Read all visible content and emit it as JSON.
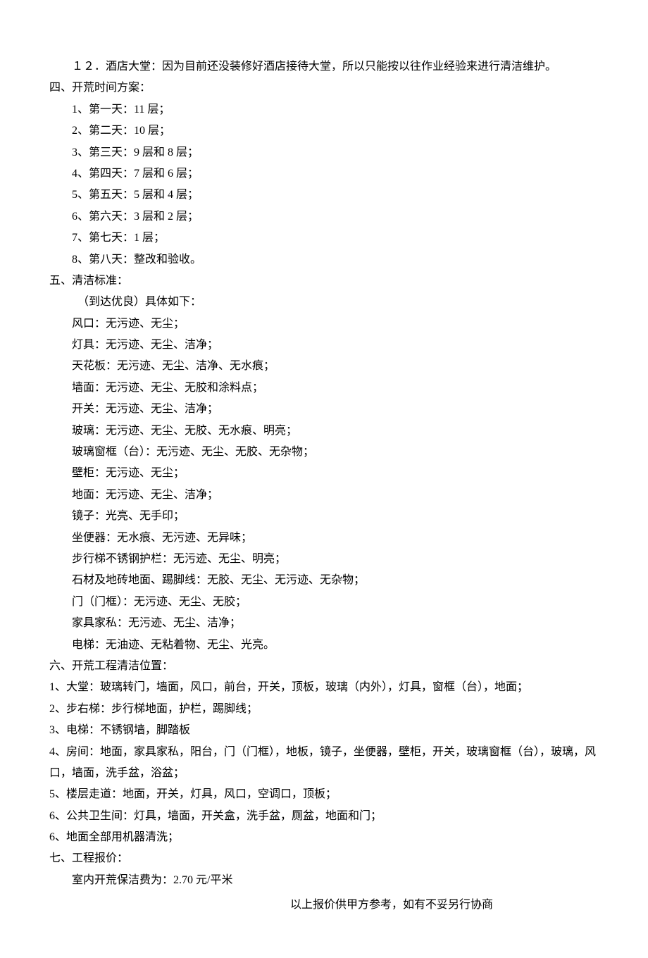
{
  "section3_item12": "１２．酒店大堂：因为目前还没装修好酒店接待大堂，所以只能按以往作业经验来进行清洁维护。",
  "section4": {
    "heading": "四、开荒时间方案：",
    "items": [
      "1、第一天：11 层；",
      "2、第二天：10 层；",
      "3、第三天：9 层和 8 层；",
      "4、第四天：7 层和 6 层；",
      "5、第五天：5 层和 4 层；",
      "6、第六天：3 层和 2 层；",
      "7、第七天：1 层；",
      "8、第八天：整改和验收。"
    ]
  },
  "section5": {
    "heading": "五、清洁标准：",
    "intro": "（到达优良）具体如下：",
    "items": [
      "风口：无污迹、无尘；",
      "灯具：无污迹、无尘、洁净；",
      "天花板：无污迹、无尘、洁净、无水痕；",
      "墙面：无污迹、无尘、无胶和涂料点；",
      "开关：无污迹、无尘、洁净；",
      "玻璃：无污迹、无尘、无胶、无水痕、明亮；",
      "玻璃窗框（台）：无污迹、无尘、无胶、无杂物；",
      "壁柜：无污迹、无尘；",
      "地面：无污迹、无尘、洁净；",
      "镜子：光亮、无手印；",
      "坐便器：无水痕、无污迹、无异味；",
      "步行梯不锈钢护栏：无污迹、无尘、明亮；",
      "石材及地砖地面、踢脚线：无胶、无尘、无污迹、无杂物；",
      "门（门框）：无污迹、无尘、无胶；",
      "家具家私：无污迹、无尘、洁净；",
      "电梯：无油迹、无粘着物、无尘、光亮。"
    ]
  },
  "section6": {
    "heading": "六、开荒工程清洁位置：",
    "items": [
      "1、大堂：玻璃转门，墙面，风口，前台，开关，顶板，玻璃（内外），灯具，窗框（台），地面；",
      "2、步右梯：步行梯地面，护栏，踢脚线；",
      "3、电梯：不锈钢墙，脚踏板",
      "4、房间：地面，家具家私，阳台，门（门框），地板，镜子，坐便器，壁柜，开关，玻璃窗框（台），玻璃，风口，墙面，洗手盆，浴盆；",
      "5、楼层走道：地面，开关，灯具，风口，空调口，顶板；",
      "6、公共卫生间：灯具，墙面，开关盒，洗手盆，厕盆，地面和门；",
      "6、地面全部用机器清洗；"
    ]
  },
  "section7": {
    "heading": "七、工程报价：",
    "line1": "室内开荒保洁费为：2.70 元/平米",
    "footer": "以上报价供甲方参考，如有不妥另行协商"
  }
}
